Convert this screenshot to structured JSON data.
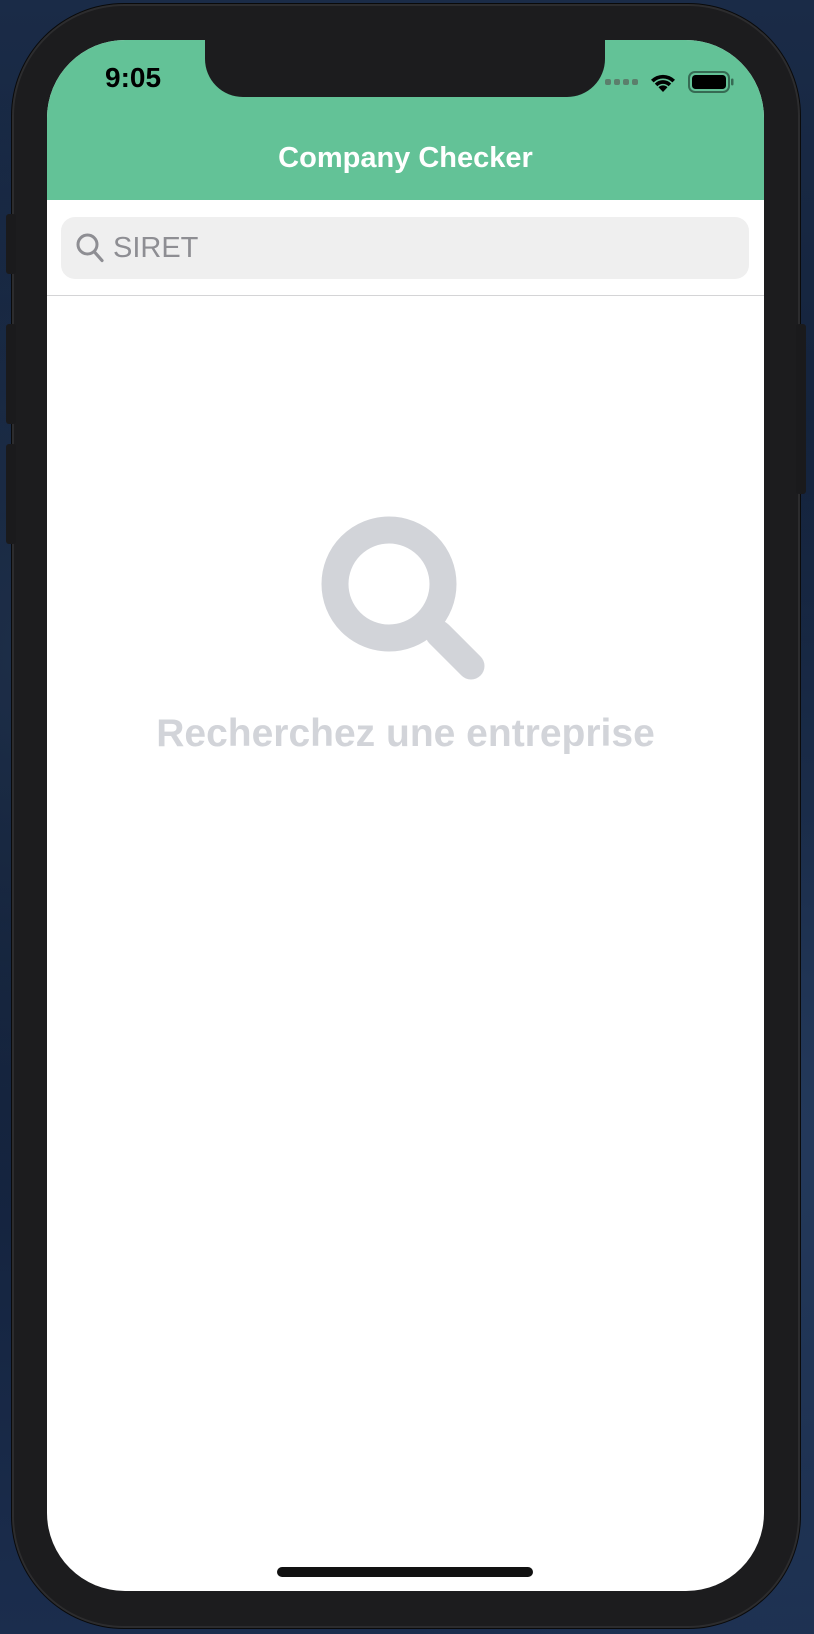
{
  "status_bar": {
    "time": "9:05",
    "icons": [
      "cellular-signal-icon",
      "wifi-icon",
      "battery-icon"
    ]
  },
  "nav": {
    "title": "Company Checker"
  },
  "search": {
    "placeholder": "SIRET",
    "value": "",
    "icon": "search-icon"
  },
  "empty_state": {
    "icon": "magnifying-glass-icon",
    "message": "Recherchez une entreprise"
  },
  "colors": {
    "header": "#63c297",
    "empty_state": "#d2d4d9",
    "search_field": "#efefef"
  }
}
